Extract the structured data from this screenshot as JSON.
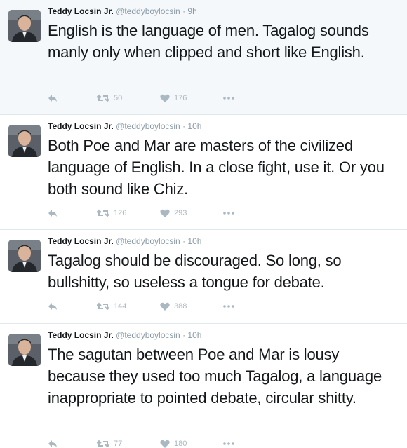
{
  "tweets": [
    {
      "name": "Teddy Locsin Jr.",
      "handle": "@teddyboylocsin",
      "separator": "·",
      "time": "9h",
      "text": "English is the language of men. Tagalog sounds manly only when clipped and short like English.",
      "retweets": "50",
      "likes": "176"
    },
    {
      "name": "Teddy Locsin Jr.",
      "handle": "@teddyboylocsin",
      "separator": "·",
      "time": "10h",
      "text": "Both Poe and Mar are masters of the civilized language of English. In a close fight, use it. Or you both sound like Chiz.",
      "retweets": "126",
      "likes": "293"
    },
    {
      "name": "Teddy Locsin Jr.",
      "handle": "@teddyboylocsin",
      "separator": "·",
      "time": "10h",
      "text": "Tagalog should be discouraged. So long, so bullshitty, so useless a tongue for debate.",
      "retweets": "144",
      "likes": "388"
    },
    {
      "name": "Teddy Locsin Jr.",
      "handle": "@teddyboylocsin",
      "separator": "·",
      "time": "10h",
      "text": "The sagutan between Poe and Mar is lousy because they used too much Tagalog, a language inappropriate to pointed debate, circular shitty.",
      "retweets": "77",
      "likes": "180"
    }
  ],
  "icons": {
    "reply": "reply-icon",
    "retweet": "retweet-icon",
    "like": "heart-icon",
    "more": "more-icon"
  },
  "colors": {
    "highlight_bg": "#f5f8fa",
    "muted": "#8899a6",
    "action_icon": "#aab8c2",
    "divider": "#e1e8ed"
  }
}
